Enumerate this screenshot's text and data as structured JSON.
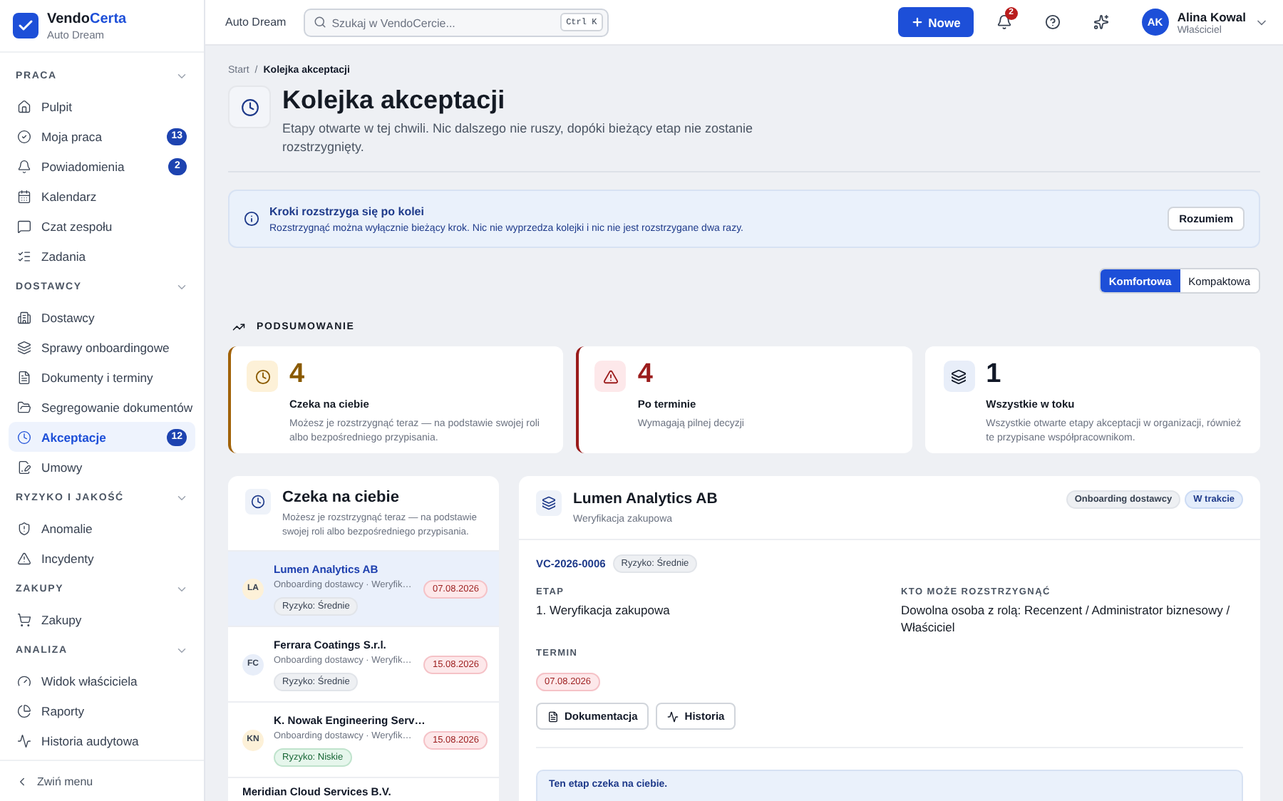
{
  "brand": {
    "name": "Vendo",
    "accent": "Certa",
    "org": "Auto Dream"
  },
  "sidebar": {
    "sections": [
      {
        "title": "PRACA",
        "expanded": true,
        "items": [
          {
            "label": "Pulpit",
            "selected": false
          },
          {
            "label": "Moja praca",
            "badge": "13",
            "selected": false
          },
          {
            "label": "Powiadomienia",
            "badge": "2",
            "selected": false
          },
          {
            "label": "Kalendarz",
            "selected": false
          },
          {
            "label": "Czat zespołu",
            "selected": false
          },
          {
            "label": "Zadania",
            "selected": false
          }
        ]
      },
      {
        "title": "DOSTAWCY",
        "expanded": true,
        "items": [
          {
            "label": "Dostawcy",
            "selected": false
          },
          {
            "label": "Sprawy onboardingowe",
            "selected": false
          },
          {
            "label": "Dokumenty i terminy",
            "selected": false
          },
          {
            "label": "Segregowanie dokumentów",
            "selected": false
          },
          {
            "label": "Akceptacje",
            "badge": "12",
            "selected": true
          },
          {
            "label": "Umowy",
            "selected": false
          }
        ]
      },
      {
        "title": "RYZYKO I JAKOŚĆ",
        "expanded": true,
        "items": [
          {
            "label": "Anomalie",
            "selected": false
          },
          {
            "label": "Incydenty",
            "selected": false
          }
        ]
      },
      {
        "title": "ZAKUPY",
        "expanded": true,
        "items": [
          {
            "label": "Zakupy",
            "selected": false
          }
        ]
      },
      {
        "title": "ANALIZA",
        "expanded": true,
        "items": [
          {
            "label": "Widok właściciela",
            "selected": false
          },
          {
            "label": "Raporty",
            "selected": false
          },
          {
            "label": "Historia audytowa",
            "selected": false
          }
        ]
      }
    ],
    "collapse": "Zwiń menu"
  },
  "topbar": {
    "org": "Auto Dream",
    "search": {
      "placeholder": "Szukaj w VendoCercie...",
      "shortcut": "Ctrl K"
    },
    "new_button": "Nowe",
    "notifications_count": "2",
    "user": {
      "initials": "AK",
      "name": "Alina Kowal",
      "role": "Właściciel"
    }
  },
  "page": {
    "breadcrumb": [
      "Start",
      "Kolejka akceptacji"
    ],
    "separator": "/",
    "title": "Kolejka akceptacji",
    "subtitle": "Etapy otwarte w tej chwili. Nic dalszego nie ruszy, dopóki bieżący etap nie zostanie rozstrzygnięty."
  },
  "banner": {
    "title": "Kroki rozstrzyga się po kolei",
    "text": "Rozstrzygnąć można wyłącznie bieżący krok. Nic nie wyprzedza kolejki i nic nie jest rozstrzygane dwa razy.",
    "button": "Rozumiem"
  },
  "density": [
    {
      "label": "Komfortowa",
      "selected": true
    },
    {
      "label": "Kompaktowa",
      "selected": false
    }
  ],
  "summary": {
    "title": "PODSUMOWANIE",
    "cards": [
      {
        "kind": "waiting",
        "value": "4",
        "label": "Czeka na ciebie",
        "text": "Możesz je rozstrzygnąć teraz — na podstawie swojej roli albo bezpośredniego przypisania."
      },
      {
        "kind": "overdue",
        "value": "4",
        "label": "Po terminie",
        "text": "Wymagają pilnej decyzji"
      },
      {
        "kind": "all",
        "value": "1",
        "label": "Wszystkie w toku",
        "text": "Wszystkie otwarte etapy akceptacji w organizacji, również te przypisane współpracownikom."
      }
    ]
  },
  "queue": {
    "title": "Czeka na ciebie",
    "text": "Możesz je rozstrzygnąć teraz — na podstawie swojej roli albo bezpośredniego przypisania.",
    "items": [
      {
        "initials": "LA",
        "color": "#fdf1d8",
        "name": "Lumen Analytics AB",
        "meta": "Onboarding dostawcy · Weryfik…",
        "date": "07.08.2026",
        "risk": {
          "label": "Ryzyko: Średnie",
          "kind": "medium"
        },
        "selected": true
      },
      {
        "initials": "FC",
        "color": "#e8eef9",
        "name": "Ferrara Coatings S.r.l.",
        "meta": "Onboarding dostawcy · Weryfik…",
        "date": "15.08.2026",
        "risk": {
          "label": "Ryzyko: Średnie",
          "kind": "medium"
        },
        "selected": false
      },
      {
        "initials": "KN",
        "color": "#fdf1d8",
        "name": "K. Nowak Engineering Serv…",
        "meta": "Onboarding dostawcy · Weryfik…",
        "date": "15.08.2026",
        "risk": {
          "label": "Ryzyko: Niskie",
          "kind": "low"
        },
        "selected": false
      },
      {
        "name": "Meridian Cloud Services B.V.",
        "selected": false
      }
    ]
  },
  "detail": {
    "title": "Lumen Analytics AB",
    "subtitle": "Weryfikacja zakupowa",
    "tags": [
      {
        "label": "Onboarding dostawcy",
        "kind": "neutral"
      },
      {
        "label": "W trakcie",
        "kind": "info"
      }
    ],
    "code": "VC-2026-0006",
    "risk": {
      "label": "Ryzyko: Średnie",
      "kind": "medium"
    },
    "fields": [
      {
        "label": "ETAP",
        "value": "1. Weryfikacja zakupowa"
      },
      {
        "label": "KTO MOŻE ROZSTRZYGNĄĆ",
        "value": "Dowolna osoba z rolą: Recenzent / Administrator biznesowy / Właściciel"
      }
    ],
    "due_label": "TERMIN",
    "due": "07.08.2026",
    "actions": [
      "Dokumentacja",
      "Historia"
    ],
    "notice": "Ten etap czeka na ciebie."
  }
}
